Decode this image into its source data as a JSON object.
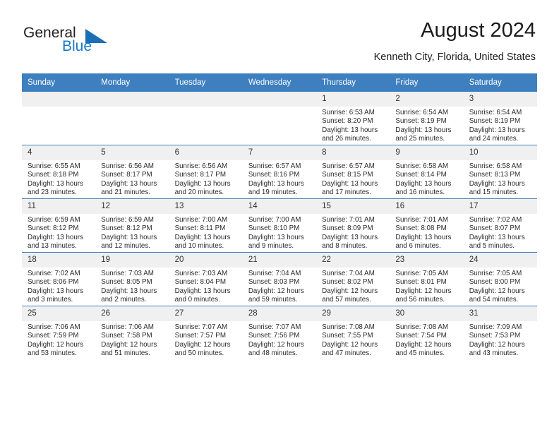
{
  "brand": {
    "name_line1": "General",
    "name_line2": "Blue",
    "accent_color": "#1a79c8",
    "triangle_color": "#1a6fb5"
  },
  "header": {
    "month_title": "August 2024",
    "location": "Kenneth City, Florida, United States"
  },
  "calendar": {
    "header_background": "#3d7fbf",
    "daynum_background": "#f0f0f0",
    "weekday_headers": [
      "Sunday",
      "Monday",
      "Tuesday",
      "Wednesday",
      "Thursday",
      "Friday",
      "Saturday"
    ],
    "weeks": [
      [
        {
          "blank": true
        },
        {
          "blank": true
        },
        {
          "blank": true
        },
        {
          "blank": true
        },
        {
          "day": "1",
          "sunrise": "Sunrise: 6:53 AM",
          "sunset": "Sunset: 8:20 PM",
          "daylight_line1": "Daylight: 13 hours",
          "daylight_line2": "and 26 minutes."
        },
        {
          "day": "2",
          "sunrise": "Sunrise: 6:54 AM",
          "sunset": "Sunset: 8:19 PM",
          "daylight_line1": "Daylight: 13 hours",
          "daylight_line2": "and 25 minutes."
        },
        {
          "day": "3",
          "sunrise": "Sunrise: 6:54 AM",
          "sunset": "Sunset: 8:19 PM",
          "daylight_line1": "Daylight: 13 hours",
          "daylight_line2": "and 24 minutes."
        }
      ],
      [
        {
          "day": "4",
          "sunrise": "Sunrise: 6:55 AM",
          "sunset": "Sunset: 8:18 PM",
          "daylight_line1": "Daylight: 13 hours",
          "daylight_line2": "and 23 minutes."
        },
        {
          "day": "5",
          "sunrise": "Sunrise: 6:56 AM",
          "sunset": "Sunset: 8:17 PM",
          "daylight_line1": "Daylight: 13 hours",
          "daylight_line2": "and 21 minutes."
        },
        {
          "day": "6",
          "sunrise": "Sunrise: 6:56 AM",
          "sunset": "Sunset: 8:17 PM",
          "daylight_line1": "Daylight: 13 hours",
          "daylight_line2": "and 20 minutes."
        },
        {
          "day": "7",
          "sunrise": "Sunrise: 6:57 AM",
          "sunset": "Sunset: 8:16 PM",
          "daylight_line1": "Daylight: 13 hours",
          "daylight_line2": "and 19 minutes."
        },
        {
          "day": "8",
          "sunrise": "Sunrise: 6:57 AM",
          "sunset": "Sunset: 8:15 PM",
          "daylight_line1": "Daylight: 13 hours",
          "daylight_line2": "and 17 minutes."
        },
        {
          "day": "9",
          "sunrise": "Sunrise: 6:58 AM",
          "sunset": "Sunset: 8:14 PM",
          "daylight_line1": "Daylight: 13 hours",
          "daylight_line2": "and 16 minutes."
        },
        {
          "day": "10",
          "sunrise": "Sunrise: 6:58 AM",
          "sunset": "Sunset: 8:13 PM",
          "daylight_line1": "Daylight: 13 hours",
          "daylight_line2": "and 15 minutes."
        }
      ],
      [
        {
          "day": "11",
          "sunrise": "Sunrise: 6:59 AM",
          "sunset": "Sunset: 8:12 PM",
          "daylight_line1": "Daylight: 13 hours",
          "daylight_line2": "and 13 minutes."
        },
        {
          "day": "12",
          "sunrise": "Sunrise: 6:59 AM",
          "sunset": "Sunset: 8:12 PM",
          "daylight_line1": "Daylight: 13 hours",
          "daylight_line2": "and 12 minutes."
        },
        {
          "day": "13",
          "sunrise": "Sunrise: 7:00 AM",
          "sunset": "Sunset: 8:11 PM",
          "daylight_line1": "Daylight: 13 hours",
          "daylight_line2": "and 10 minutes."
        },
        {
          "day": "14",
          "sunrise": "Sunrise: 7:00 AM",
          "sunset": "Sunset: 8:10 PM",
          "daylight_line1": "Daylight: 13 hours",
          "daylight_line2": "and 9 minutes."
        },
        {
          "day": "15",
          "sunrise": "Sunrise: 7:01 AM",
          "sunset": "Sunset: 8:09 PM",
          "daylight_line1": "Daylight: 13 hours",
          "daylight_line2": "and 8 minutes."
        },
        {
          "day": "16",
          "sunrise": "Sunrise: 7:01 AM",
          "sunset": "Sunset: 8:08 PM",
          "daylight_line1": "Daylight: 13 hours",
          "daylight_line2": "and 6 minutes."
        },
        {
          "day": "17",
          "sunrise": "Sunrise: 7:02 AM",
          "sunset": "Sunset: 8:07 PM",
          "daylight_line1": "Daylight: 13 hours",
          "daylight_line2": "and 5 minutes."
        }
      ],
      [
        {
          "day": "18",
          "sunrise": "Sunrise: 7:02 AM",
          "sunset": "Sunset: 8:06 PM",
          "daylight_line1": "Daylight: 13 hours",
          "daylight_line2": "and 3 minutes."
        },
        {
          "day": "19",
          "sunrise": "Sunrise: 7:03 AM",
          "sunset": "Sunset: 8:05 PM",
          "daylight_line1": "Daylight: 13 hours",
          "daylight_line2": "and 2 minutes."
        },
        {
          "day": "20",
          "sunrise": "Sunrise: 7:03 AM",
          "sunset": "Sunset: 8:04 PM",
          "daylight_line1": "Daylight: 13 hours",
          "daylight_line2": "and 0 minutes."
        },
        {
          "day": "21",
          "sunrise": "Sunrise: 7:04 AM",
          "sunset": "Sunset: 8:03 PM",
          "daylight_line1": "Daylight: 12 hours",
          "daylight_line2": "and 59 minutes."
        },
        {
          "day": "22",
          "sunrise": "Sunrise: 7:04 AM",
          "sunset": "Sunset: 8:02 PM",
          "daylight_line1": "Daylight: 12 hours",
          "daylight_line2": "and 57 minutes."
        },
        {
          "day": "23",
          "sunrise": "Sunrise: 7:05 AM",
          "sunset": "Sunset: 8:01 PM",
          "daylight_line1": "Daylight: 12 hours",
          "daylight_line2": "and 56 minutes."
        },
        {
          "day": "24",
          "sunrise": "Sunrise: 7:05 AM",
          "sunset": "Sunset: 8:00 PM",
          "daylight_line1": "Daylight: 12 hours",
          "daylight_line2": "and 54 minutes."
        }
      ],
      [
        {
          "day": "25",
          "sunrise": "Sunrise: 7:06 AM",
          "sunset": "Sunset: 7:59 PM",
          "daylight_line1": "Daylight: 12 hours",
          "daylight_line2": "and 53 minutes."
        },
        {
          "day": "26",
          "sunrise": "Sunrise: 7:06 AM",
          "sunset": "Sunset: 7:58 PM",
          "daylight_line1": "Daylight: 12 hours",
          "daylight_line2": "and 51 minutes."
        },
        {
          "day": "27",
          "sunrise": "Sunrise: 7:07 AM",
          "sunset": "Sunset: 7:57 PM",
          "daylight_line1": "Daylight: 12 hours",
          "daylight_line2": "and 50 minutes."
        },
        {
          "day": "28",
          "sunrise": "Sunrise: 7:07 AM",
          "sunset": "Sunset: 7:56 PM",
          "daylight_line1": "Daylight: 12 hours",
          "daylight_line2": "and 48 minutes."
        },
        {
          "day": "29",
          "sunrise": "Sunrise: 7:08 AM",
          "sunset": "Sunset: 7:55 PM",
          "daylight_line1": "Daylight: 12 hours",
          "daylight_line2": "and 47 minutes."
        },
        {
          "day": "30",
          "sunrise": "Sunrise: 7:08 AM",
          "sunset": "Sunset: 7:54 PM",
          "daylight_line1": "Daylight: 12 hours",
          "daylight_line2": "and 45 minutes."
        },
        {
          "day": "31",
          "sunrise": "Sunrise: 7:09 AM",
          "sunset": "Sunset: 7:53 PM",
          "daylight_line1": "Daylight: 12 hours",
          "daylight_line2": "and 43 minutes."
        }
      ]
    ]
  }
}
